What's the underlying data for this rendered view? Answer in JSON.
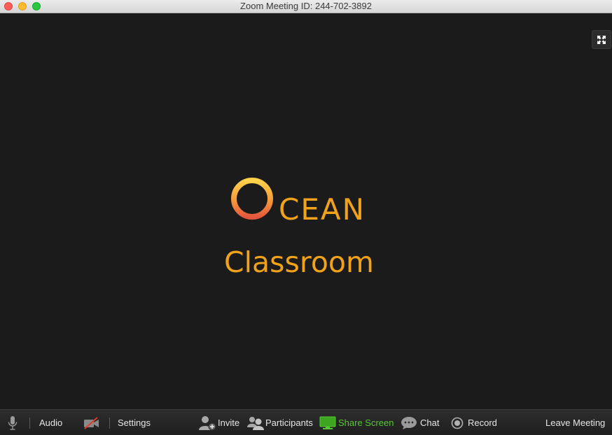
{
  "window": {
    "title": "Zoom Meeting ID: 244-702-3892"
  },
  "logo": {
    "word": "CEAN",
    "subtitle": "Classroom"
  },
  "toolbar": {
    "audio_label": "Audio",
    "settings_label": "Settings",
    "invite_label": "Invite",
    "participants_label": "Participants",
    "share_label": "Share Screen",
    "chat_label": "Chat",
    "record_label": "Record",
    "leave_label": "Leave Meeting"
  },
  "colors": {
    "accent_orange": "#f0a21a",
    "share_green": "#58c832",
    "video_bg": "#1b1b1b"
  },
  "icons": [
    "mic-icon",
    "video-off-icon",
    "invite-icon",
    "participants-icon",
    "share-screen-icon",
    "chat-icon",
    "record-icon",
    "fullscreen-icon"
  ]
}
